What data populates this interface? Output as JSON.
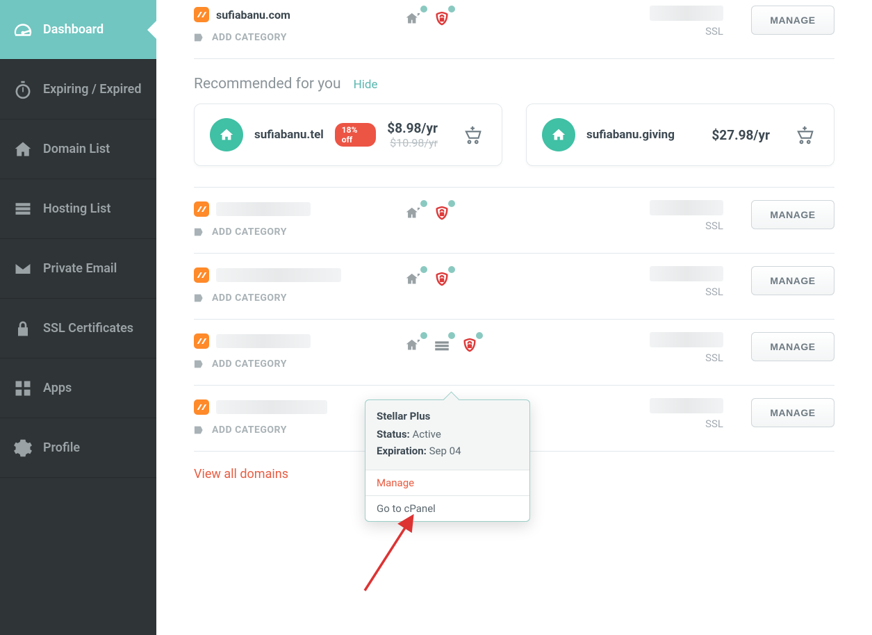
{
  "sidebar": {
    "items": [
      {
        "label": "Dashboard",
        "icon": "gauge-icon"
      },
      {
        "label": "Expiring / Expired",
        "icon": "stopwatch-icon"
      },
      {
        "label": "Domain List",
        "icon": "home-icon"
      },
      {
        "label": "Hosting List",
        "icon": "server-icon"
      },
      {
        "label": "Private Email",
        "icon": "mail-icon"
      },
      {
        "label": "SSL Certificates",
        "icon": "lock-icon"
      },
      {
        "label": "Apps",
        "icon": "apps-icon"
      },
      {
        "label": "Profile",
        "icon": "gear-icon"
      }
    ],
    "active_index": 0
  },
  "main": {
    "add_category_label": "ADD CATEGORY",
    "manage_label": "MANAGE",
    "ssl_note": "SSL",
    "view_all_label": "View all domains",
    "recommended": {
      "heading": "Recommended for you",
      "hide_label": "Hide",
      "cards": [
        {
          "name": "sufiabanu.tel",
          "badge": "18% off",
          "price": "$8.98/yr",
          "old_price": "$10.98/yr"
        },
        {
          "name": "sufiabanu.giving",
          "badge": "",
          "price": "$27.98/yr",
          "old_price": ""
        }
      ]
    },
    "domains": [
      {
        "name": "sufiabanu.com",
        "redacted": false,
        "has_hosting": false
      },
      {
        "name": "",
        "redacted": true,
        "has_hosting": false
      },
      {
        "name": "",
        "redacted": true,
        "has_hosting": false
      },
      {
        "name": "",
        "redacted": true,
        "has_hosting": true
      },
      {
        "name": "",
        "redacted": true,
        "has_hosting": false
      }
    ],
    "popover": {
      "title": "Stellar Plus",
      "status_label": "Status:",
      "status_value": "Active",
      "exp_label": "Expiration:",
      "exp_value": "Sep 04",
      "actions": [
        "Manage",
        "Go to cPanel"
      ]
    }
  }
}
